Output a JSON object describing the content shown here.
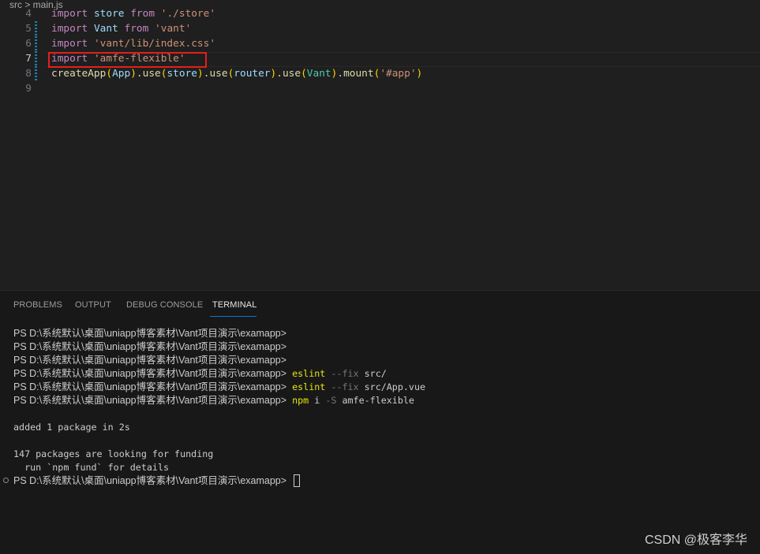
{
  "breadcrumb": "src > main.js",
  "editor": {
    "lines": [
      {
        "n": "4",
        "tokens": [
          [
            "kw",
            "import"
          ],
          [
            "tx",
            " "
          ],
          [
            "id",
            "store"
          ],
          [
            "tx",
            " "
          ],
          [
            "kw",
            "from"
          ],
          [
            "tx",
            " "
          ],
          [
            "str",
            "'./store'"
          ]
        ]
      },
      {
        "n": "5",
        "tokens": [
          [
            "kw",
            "import"
          ],
          [
            "tx",
            " "
          ],
          [
            "id",
            "Vant"
          ],
          [
            "tx",
            " "
          ],
          [
            "kw",
            "from"
          ],
          [
            "tx",
            " "
          ],
          [
            "str",
            "'vant'"
          ]
        ]
      },
      {
        "n": "6",
        "tokens": [
          [
            "kw",
            "import"
          ],
          [
            "tx",
            " "
          ],
          [
            "str",
            "'vant/lib/index.css'"
          ]
        ]
      },
      {
        "n": "7",
        "tokens": [
          [
            "kw",
            "import"
          ],
          [
            "tx",
            " "
          ],
          [
            "str",
            "'amfe-flexible'"
          ]
        ]
      },
      {
        "n": "8",
        "tokens": [
          [
            "fn",
            "createApp"
          ],
          [
            "p1",
            "("
          ],
          [
            "id",
            "App"
          ],
          [
            "p1",
            ")"
          ],
          [
            "tx",
            "."
          ],
          [
            "fn",
            "use"
          ],
          [
            "p1",
            "("
          ],
          [
            "id",
            "store"
          ],
          [
            "p1",
            ")"
          ],
          [
            "tx",
            "."
          ],
          [
            "fn",
            "use"
          ],
          [
            "p1",
            "("
          ],
          [
            "id",
            "router"
          ],
          [
            "p1",
            ")"
          ],
          [
            "tx",
            "."
          ],
          [
            "fn",
            "use"
          ],
          [
            "p1",
            "("
          ],
          [
            "cls",
            "Vant"
          ],
          [
            "p1",
            ")"
          ],
          [
            "tx",
            "."
          ],
          [
            "fn",
            "mount"
          ],
          [
            "p1",
            "("
          ],
          [
            "str",
            "'#app'"
          ],
          [
            "p1",
            ")"
          ]
        ]
      },
      {
        "n": "9",
        "tokens": []
      }
    ]
  },
  "panel": {
    "tabs": [
      "PROBLEMS",
      "OUTPUT",
      "DEBUG CONSOLE",
      "TERMINAL"
    ],
    "active": "TERMINAL"
  },
  "terminal": {
    "prompt": "PS D:\\系统默认\\桌面\\uniapp博客素材\\Vant项目演示\\examapp>",
    "lines": [
      {
        "prompt": true,
        "cmd": "",
        "args": []
      },
      {
        "prompt": true,
        "cmd": "",
        "args": []
      },
      {
        "prompt": true,
        "cmd": "",
        "args": []
      },
      {
        "prompt": true,
        "cmd": "eslint",
        "flag": " --fix",
        "rest": " src/"
      },
      {
        "prompt": true,
        "cmd": "eslint",
        "flag": " --fix",
        "rest": " src/App.vue"
      },
      {
        "prompt": true,
        "cmd": "npm",
        "rest": " i",
        "flag": " -S",
        "rest2": " amfe-flexible"
      },
      {
        "text": ""
      },
      {
        "text": "added 1 package in 2s"
      },
      {
        "text": ""
      },
      {
        "text": "147 packages are looking for funding"
      },
      {
        "text": "  run `npm fund` for details"
      },
      {
        "prompt": true,
        "cursor": true
      }
    ]
  },
  "watermark": "CSDN @极客李华"
}
